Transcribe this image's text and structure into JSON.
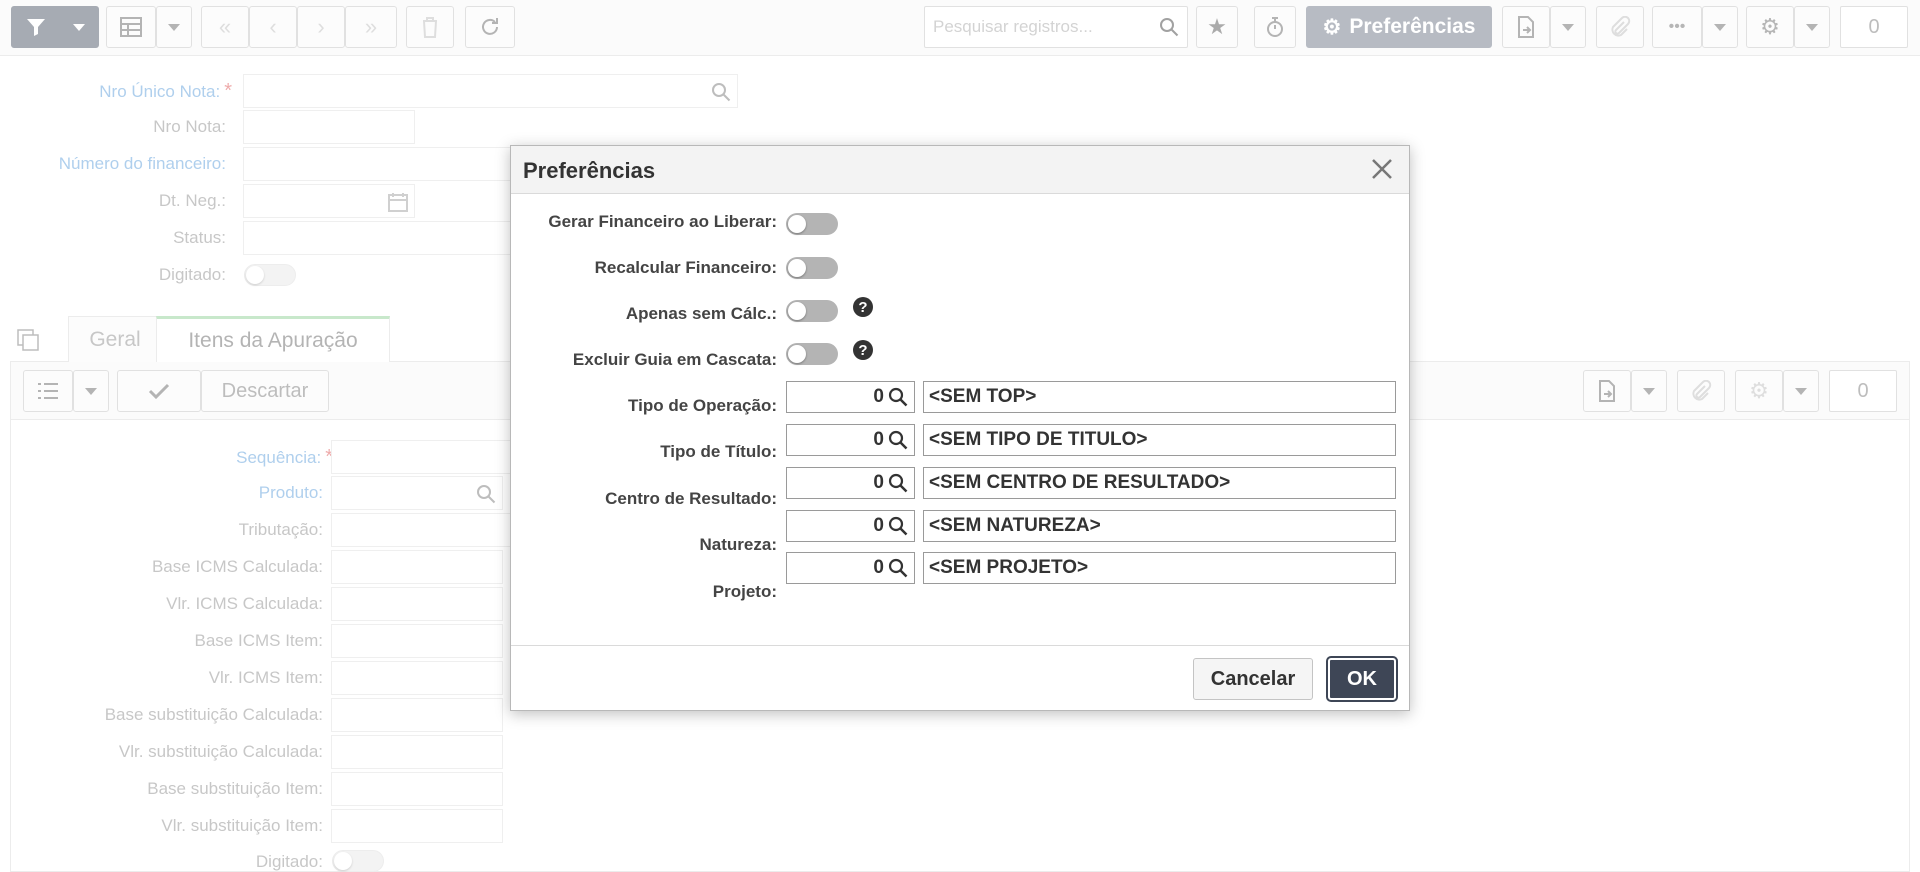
{
  "toolbar": {
    "search_placeholder": "Pesquisar registros...",
    "preferences_label": "Preferências",
    "count": "0"
  },
  "form": {
    "fields": [
      {
        "label": "Nro Único Nota:",
        "required": "*"
      },
      {
        "label": "Nro Nota:"
      },
      {
        "label": "Número do financeiro:"
      },
      {
        "label": "Dt. Neg.:"
      },
      {
        "label": "Status:"
      },
      {
        "label": "Digitado:"
      }
    ]
  },
  "tabs": [
    {
      "label": "Geral"
    },
    {
      "label": "Itens da Apuração"
    }
  ],
  "sub_toolbar": {
    "discard_label": "Descartar",
    "count": "0"
  },
  "sub_form": {
    "fields": [
      {
        "label": "Sequência:",
        "required": "*"
      },
      {
        "label": "Produto:"
      },
      {
        "label": "Tributação:"
      },
      {
        "label": "Base ICMS Calculada:"
      },
      {
        "label": "Vlr. ICMS Calculada:"
      },
      {
        "label": "Base ICMS Item:"
      },
      {
        "label": "Vlr. ICMS Item:"
      },
      {
        "label": "Base substituição Calculada:"
      },
      {
        "label": "Vlr. substituição Calculada:"
      },
      {
        "label": "Base substituição Item:"
      },
      {
        "label": "Vlr. substituição Item:"
      },
      {
        "label": "Digitado:"
      }
    ]
  },
  "dialog": {
    "title": "Preferências",
    "toggles": [
      {
        "label": "Gerar Financeiro ao Liberar:",
        "help": ""
      },
      {
        "label": "Recalcular Financeiro:",
        "help": ""
      },
      {
        "label": "Apenas sem Cálc.:",
        "help": "?"
      },
      {
        "label": "Excluir Guia em Cascata:",
        "help": "?"
      }
    ],
    "lookups": [
      {
        "label": "Tipo de Operação:",
        "code": "0",
        "description": "<SEM TOP>"
      },
      {
        "label": "Tipo de Título:",
        "code": "0",
        "description": "<SEM TIPO DE TITULO>"
      },
      {
        "label": "Centro de Resultado:",
        "code": "0",
        "description": "<SEM CENTRO DE RESULTADO>"
      },
      {
        "label": "Natureza:",
        "code": "0",
        "description": "<SEM NATUREZA>"
      },
      {
        "label": "Projeto:",
        "code": "0",
        "description": "<SEM PROJETO>"
      }
    ],
    "cancel_label": "Cancelar",
    "ok_label": "OK"
  }
}
